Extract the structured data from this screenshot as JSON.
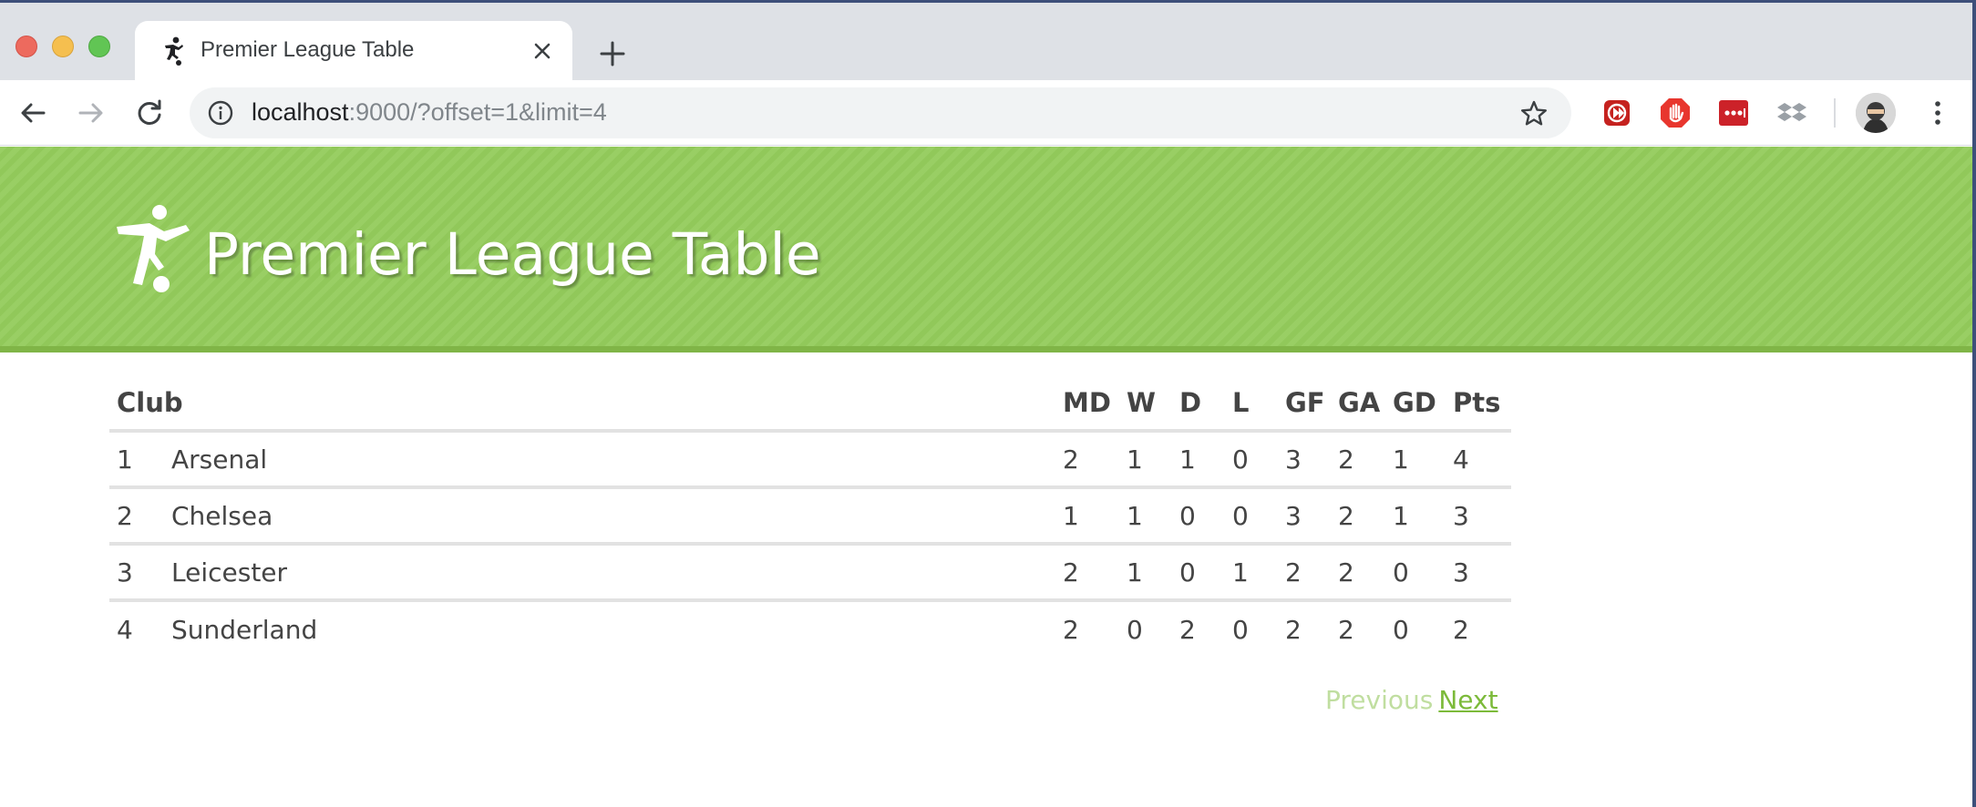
{
  "browser": {
    "tab_title": "Premier League Table",
    "url_host": "localhost",
    "url_rest": ":9000/?offset=1&limit=4",
    "icons": {
      "favicon": "soccer-player-icon",
      "tab_close": "close-icon",
      "new_tab": "plus-icon",
      "back": "arrow-left-icon",
      "forward": "arrow-right-icon",
      "reload": "reload-icon",
      "info": "info-icon",
      "bookmark": "star-icon",
      "menu": "kebab-menu-icon"
    }
  },
  "header": {
    "title": "Premier League Table",
    "logo": "soccer-player-icon",
    "accent_color": "#94cc5c"
  },
  "table": {
    "columns": {
      "club": "Club",
      "md": "MD",
      "w": "W",
      "d": "D",
      "l": "L",
      "gf": "GF",
      "ga": "GA",
      "gd": "GD",
      "pts": "Pts"
    },
    "rows": [
      {
        "pos": "1",
        "club": "Arsenal",
        "md": "2",
        "w": "1",
        "d": "1",
        "l": "0",
        "gf": "3",
        "ga": "2",
        "gd": "1",
        "pts": "4"
      },
      {
        "pos": "2",
        "club": "Chelsea",
        "md": "1",
        "w": "1",
        "d": "0",
        "l": "0",
        "gf": "3",
        "ga": "2",
        "gd": "1",
        "pts": "3"
      },
      {
        "pos": "3",
        "club": "Leicester",
        "md": "2",
        "w": "1",
        "d": "0",
        "l": "1",
        "gf": "2",
        "ga": "2",
        "gd": "0",
        "pts": "3"
      },
      {
        "pos": "4",
        "club": "Sunderland",
        "md": "2",
        "w": "0",
        "d": "2",
        "l": "0",
        "gf": "2",
        "ga": "2",
        "gd": "0",
        "pts": "2"
      }
    ]
  },
  "pagination": {
    "previous_label": "Previous",
    "next_label": "Next"
  }
}
